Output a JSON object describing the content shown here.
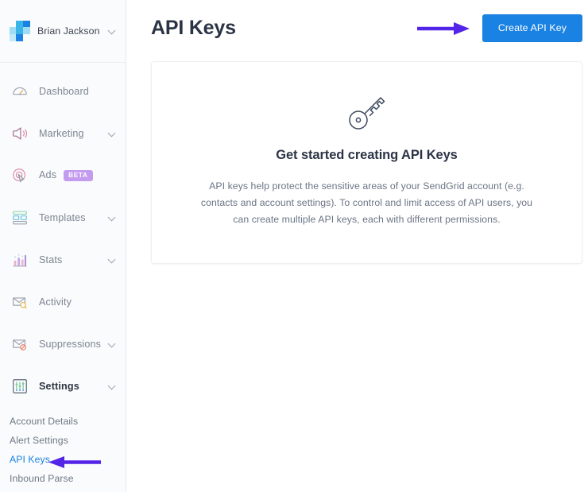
{
  "brand": {
    "accent_blue": "#1a82e2",
    "annotation_purple": "#5325e8",
    "logo_name": "sendgrid-logo"
  },
  "sidebar": {
    "account": {
      "name": "Brian Jackson",
      "chevron_icon": "chevron-down-icon",
      "logo_icon": "sendgrid-logo-icon"
    },
    "items": [
      {
        "label": "Dashboard",
        "icon": "gauge-icon",
        "expandable": false,
        "active": false,
        "badge": null
      },
      {
        "label": "Marketing",
        "icon": "megaphone-icon",
        "expandable": true,
        "active": false,
        "badge": null
      },
      {
        "label": "Ads",
        "icon": "target-icon",
        "expandable": false,
        "active": false,
        "badge": "BETA"
      },
      {
        "label": "Templates",
        "icon": "layout-icon",
        "expandable": true,
        "active": false,
        "badge": null
      },
      {
        "label": "Stats",
        "icon": "bar-chart-icon",
        "expandable": true,
        "active": false,
        "badge": null
      },
      {
        "label": "Activity",
        "icon": "mail-search-icon",
        "expandable": false,
        "active": false,
        "badge": null
      },
      {
        "label": "Suppressions",
        "icon": "mail-block-icon",
        "expandable": true,
        "active": false,
        "badge": null
      },
      {
        "label": "Settings",
        "icon": "sliders-icon",
        "expandable": true,
        "active": true,
        "badge": null
      }
    ],
    "subitems": [
      {
        "label": "Account Details",
        "selected": false
      },
      {
        "label": "Alert Settings",
        "selected": false
      },
      {
        "label": "API Keys",
        "selected": true
      },
      {
        "label": "Inbound Parse",
        "selected": false
      }
    ]
  },
  "header": {
    "title": "API Keys",
    "create_button_label": "Create API Key"
  },
  "empty_state": {
    "icon": "key-icon",
    "title": "Get started creating API Keys",
    "body": "API keys help protect the sensitive areas of your SendGrid account (e.g. contacts and account settings). To control and limit access of API users, you can create multiple API keys, each with different permissions."
  },
  "annotations": [
    {
      "name": "arrow-to-create-button",
      "direction": "right",
      "color": "#5325e8"
    },
    {
      "name": "arrow-to-api-keys-link",
      "direction": "left",
      "color": "#5325e8"
    }
  ]
}
